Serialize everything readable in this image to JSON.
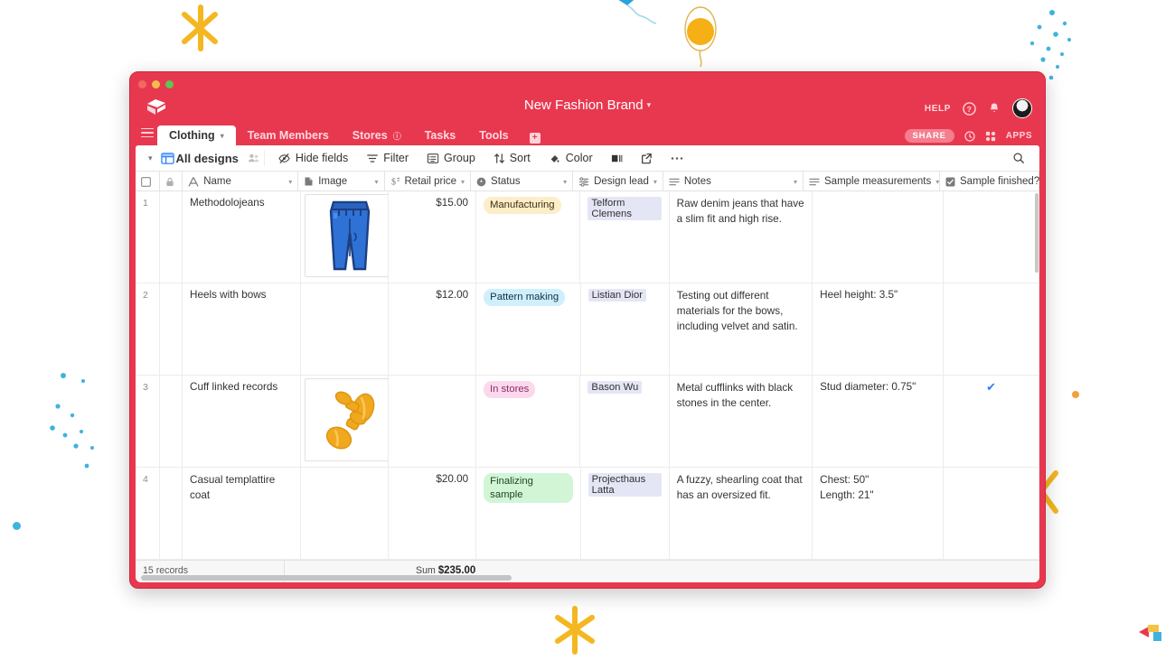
{
  "window": {
    "traffic_lights": [
      "close",
      "minimize",
      "maximize"
    ],
    "base_title": "New Fashion Brand",
    "base_title_caret": "▾",
    "help_label": "HELP",
    "icons": {
      "logo": "airtable-cube-icon",
      "help": "question-circle-icon",
      "bell": "notification-bell-icon",
      "avatar": "user-avatar"
    }
  },
  "tabs": {
    "menu_icon": "hamburger-menu-icon",
    "items": [
      {
        "label": "Clothing",
        "active": true,
        "caret": "▾"
      },
      {
        "label": "Team Members",
        "active": false
      },
      {
        "label": "Stores",
        "active": false,
        "badge": "ⓘ"
      },
      {
        "label": "Tasks",
        "active": false
      },
      {
        "label": "Tools",
        "active": false
      }
    ],
    "add_label": "+",
    "right": {
      "share_label": "SHARE",
      "history_icon": "history-clock-icon",
      "apps_label": "APPS",
      "apps_icon": "apps-grid-icon"
    }
  },
  "toolbar": {
    "view_caret": "▾",
    "view_icon": "grid-view-icon",
    "view_name": "All designs",
    "collaborators_icon": "collaborators-icon",
    "buttons": [
      {
        "label": "Hide fields",
        "icon": "hide-fields-icon"
      },
      {
        "label": "Filter",
        "icon": "filter-icon"
      },
      {
        "label": "Group",
        "icon": "group-icon"
      },
      {
        "label": "Sort",
        "icon": "sort-icon"
      },
      {
        "label": "Color",
        "icon": "color-palette-icon"
      }
    ],
    "row_height_icon": "row-height-icon",
    "share_view_icon": "share-view-icon",
    "more_icon": "more-ellipsis-icon",
    "search_icon": "search-icon"
  },
  "grid": {
    "columns": [
      {
        "key": "check",
        "label": "",
        "icon": "checkbox-icon",
        "caret": false
      },
      {
        "key": "lock",
        "label": "",
        "icon": "lock-icon",
        "caret": false
      },
      {
        "key": "name",
        "label": "Name",
        "icon": "text-field-icon",
        "caret": true
      },
      {
        "key": "image",
        "label": "Image",
        "icon": "attachment-icon",
        "caret": true
      },
      {
        "key": "price",
        "label": "Retail price",
        "icon": "currency-icon",
        "caret": true
      },
      {
        "key": "status",
        "label": "Status",
        "icon": "single-select-icon",
        "caret": true
      },
      {
        "key": "lead",
        "label": "Design lead",
        "icon": "multi-select-icon",
        "caret": true
      },
      {
        "key": "notes",
        "label": "Notes",
        "icon": "long-text-icon",
        "caret": true
      },
      {
        "key": "meas",
        "label": "Sample measurements",
        "icon": "long-text-icon",
        "caret": true
      },
      {
        "key": "fin",
        "label": "Sample finished?",
        "icon": "checkbox-field-icon",
        "caret": false
      }
    ],
    "rows": [
      {
        "num": "1",
        "name": "Methodolojeans",
        "image": "blue-jeans-thumbnail",
        "price": "$15.00",
        "status": "Manufacturing",
        "status_bg": "#fdeec8",
        "status_fg": "#3c2f12",
        "lead": "Telform Clemens",
        "notes": "Raw denim jeans that have a slim fit and high rise.",
        "measurements": "",
        "finished": false
      },
      {
        "num": "2",
        "name": "Heels with bows",
        "image": "",
        "price": "$12.00",
        "status": "Pattern making",
        "status_bg": "#cfeffc",
        "status_fg": "#123040",
        "lead": "Listian Dior",
        "notes": "Testing out different materials for the bows, including velvet and satin.",
        "measurements": "Heel height: 3.5\"",
        "finished": false
      },
      {
        "num": "3",
        "name": "Cuff linked records",
        "image": "gold-cufflinks-thumbnail",
        "price": "",
        "status": "In stores",
        "status_bg": "#fcd8ec",
        "status_fg": "#8a2f67",
        "lead": "Bason Wu",
        "notes": "Metal cufflinks with black stones in the center.",
        "measurements": "Stud diameter: 0.75\"",
        "finished": true
      },
      {
        "num": "4",
        "name": "Casual templattire coat",
        "image": "",
        "price": "$20.00",
        "status": "Finalizing sample",
        "status_bg": "#d2f5d6",
        "status_fg": "#1d4726",
        "lead": "Projecthaus Latta",
        "notes": "A fuzzy, shearling coat that has an oversized fit.",
        "measurements": "Chest: 50\"\nLength: 21\"",
        "finished": false
      }
    ]
  },
  "footer": {
    "records_label": "15 records",
    "sum_label": "Sum",
    "sum_value": "$235.00"
  },
  "colors": {
    "brand_red": "#e8384f",
    "accent_blue": "#2d7ff9",
    "doodle_yellow": "#f5b721",
    "doodle_blue": "#2fa8e0"
  },
  "decorations": {
    "bottom_right_logo": "airtable-logo",
    "items": [
      "yellow-asterisk",
      "blue-kite",
      "yellow-balloon",
      "blue-dots",
      "yellow-star"
    ]
  }
}
